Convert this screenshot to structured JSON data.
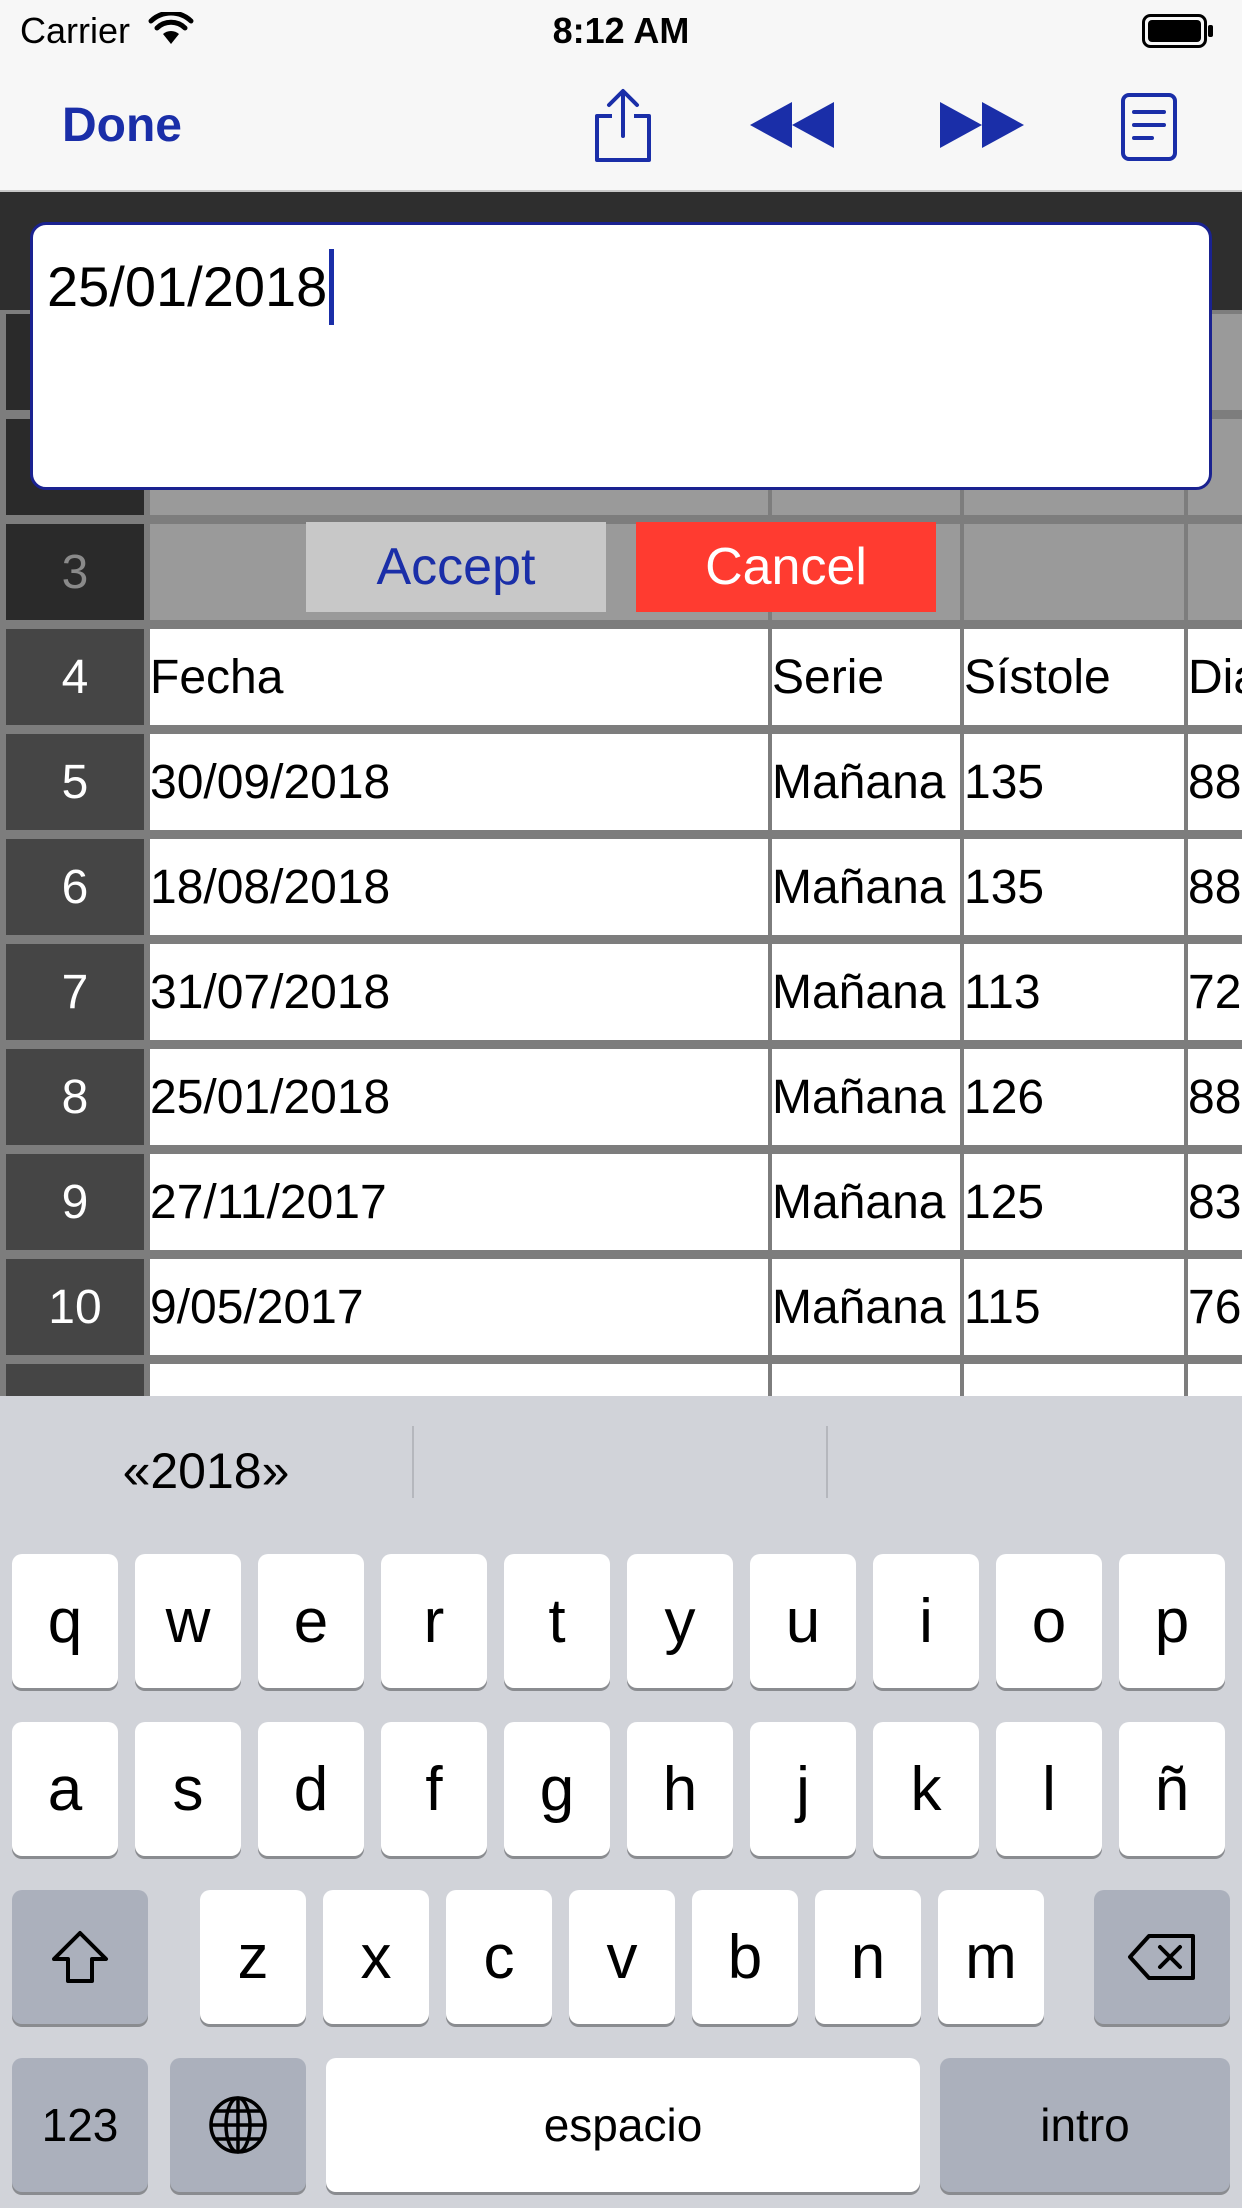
{
  "status_bar": {
    "carrier": "Carrier",
    "time": "8:12 AM"
  },
  "toolbar": {
    "done_label": "Done",
    "icons": [
      "share-icon",
      "rewind-icon",
      "fast-forward-icon",
      "document-icon"
    ]
  },
  "editor": {
    "value": "25/01/2018",
    "accept_label": "Accept",
    "cancel_label": "Cancel"
  },
  "sheet": {
    "hidden_row_3": "3",
    "header": {
      "num": "4",
      "fecha": "Fecha",
      "serie": "Serie",
      "sistole": "Sístole",
      "diastole": "Dia"
    },
    "rows": [
      {
        "num": "5",
        "fecha": "30/09/2018",
        "serie": "Mañana",
        "sistole": "135",
        "diastole": "88"
      },
      {
        "num": "6",
        "fecha": "18/08/2018",
        "serie": "Mañana",
        "sistole": "135",
        "diastole": "88"
      },
      {
        "num": "7",
        "fecha": "31/07/2018",
        "serie": "Mañana",
        "sistole": "113",
        "diastole": "72"
      },
      {
        "num": "8",
        "fecha": "25/01/2018",
        "serie": "Mañana",
        "sistole": "126",
        "diastole": "88"
      },
      {
        "num": "9",
        "fecha": "27/11/2017",
        "serie": "Mañana",
        "sistole": "125",
        "diastole": "83"
      },
      {
        "num": "10",
        "fecha": "9/05/2017",
        "serie": "Mañana",
        "sistole": "115",
        "diastole": "76"
      }
    ]
  },
  "keyboard": {
    "suggestion": "«2018»",
    "row1": [
      "q",
      "w",
      "e",
      "r",
      "t",
      "y",
      "u",
      "i",
      "o",
      "p"
    ],
    "row2": [
      "a",
      "s",
      "d",
      "f",
      "g",
      "h",
      "j",
      "k",
      "l",
      "ñ"
    ],
    "row3": [
      "z",
      "x",
      "c",
      "v",
      "b",
      "n",
      "m"
    ],
    "numbers_label": "123",
    "space_label": "espacio",
    "return_label": "intro"
  }
}
